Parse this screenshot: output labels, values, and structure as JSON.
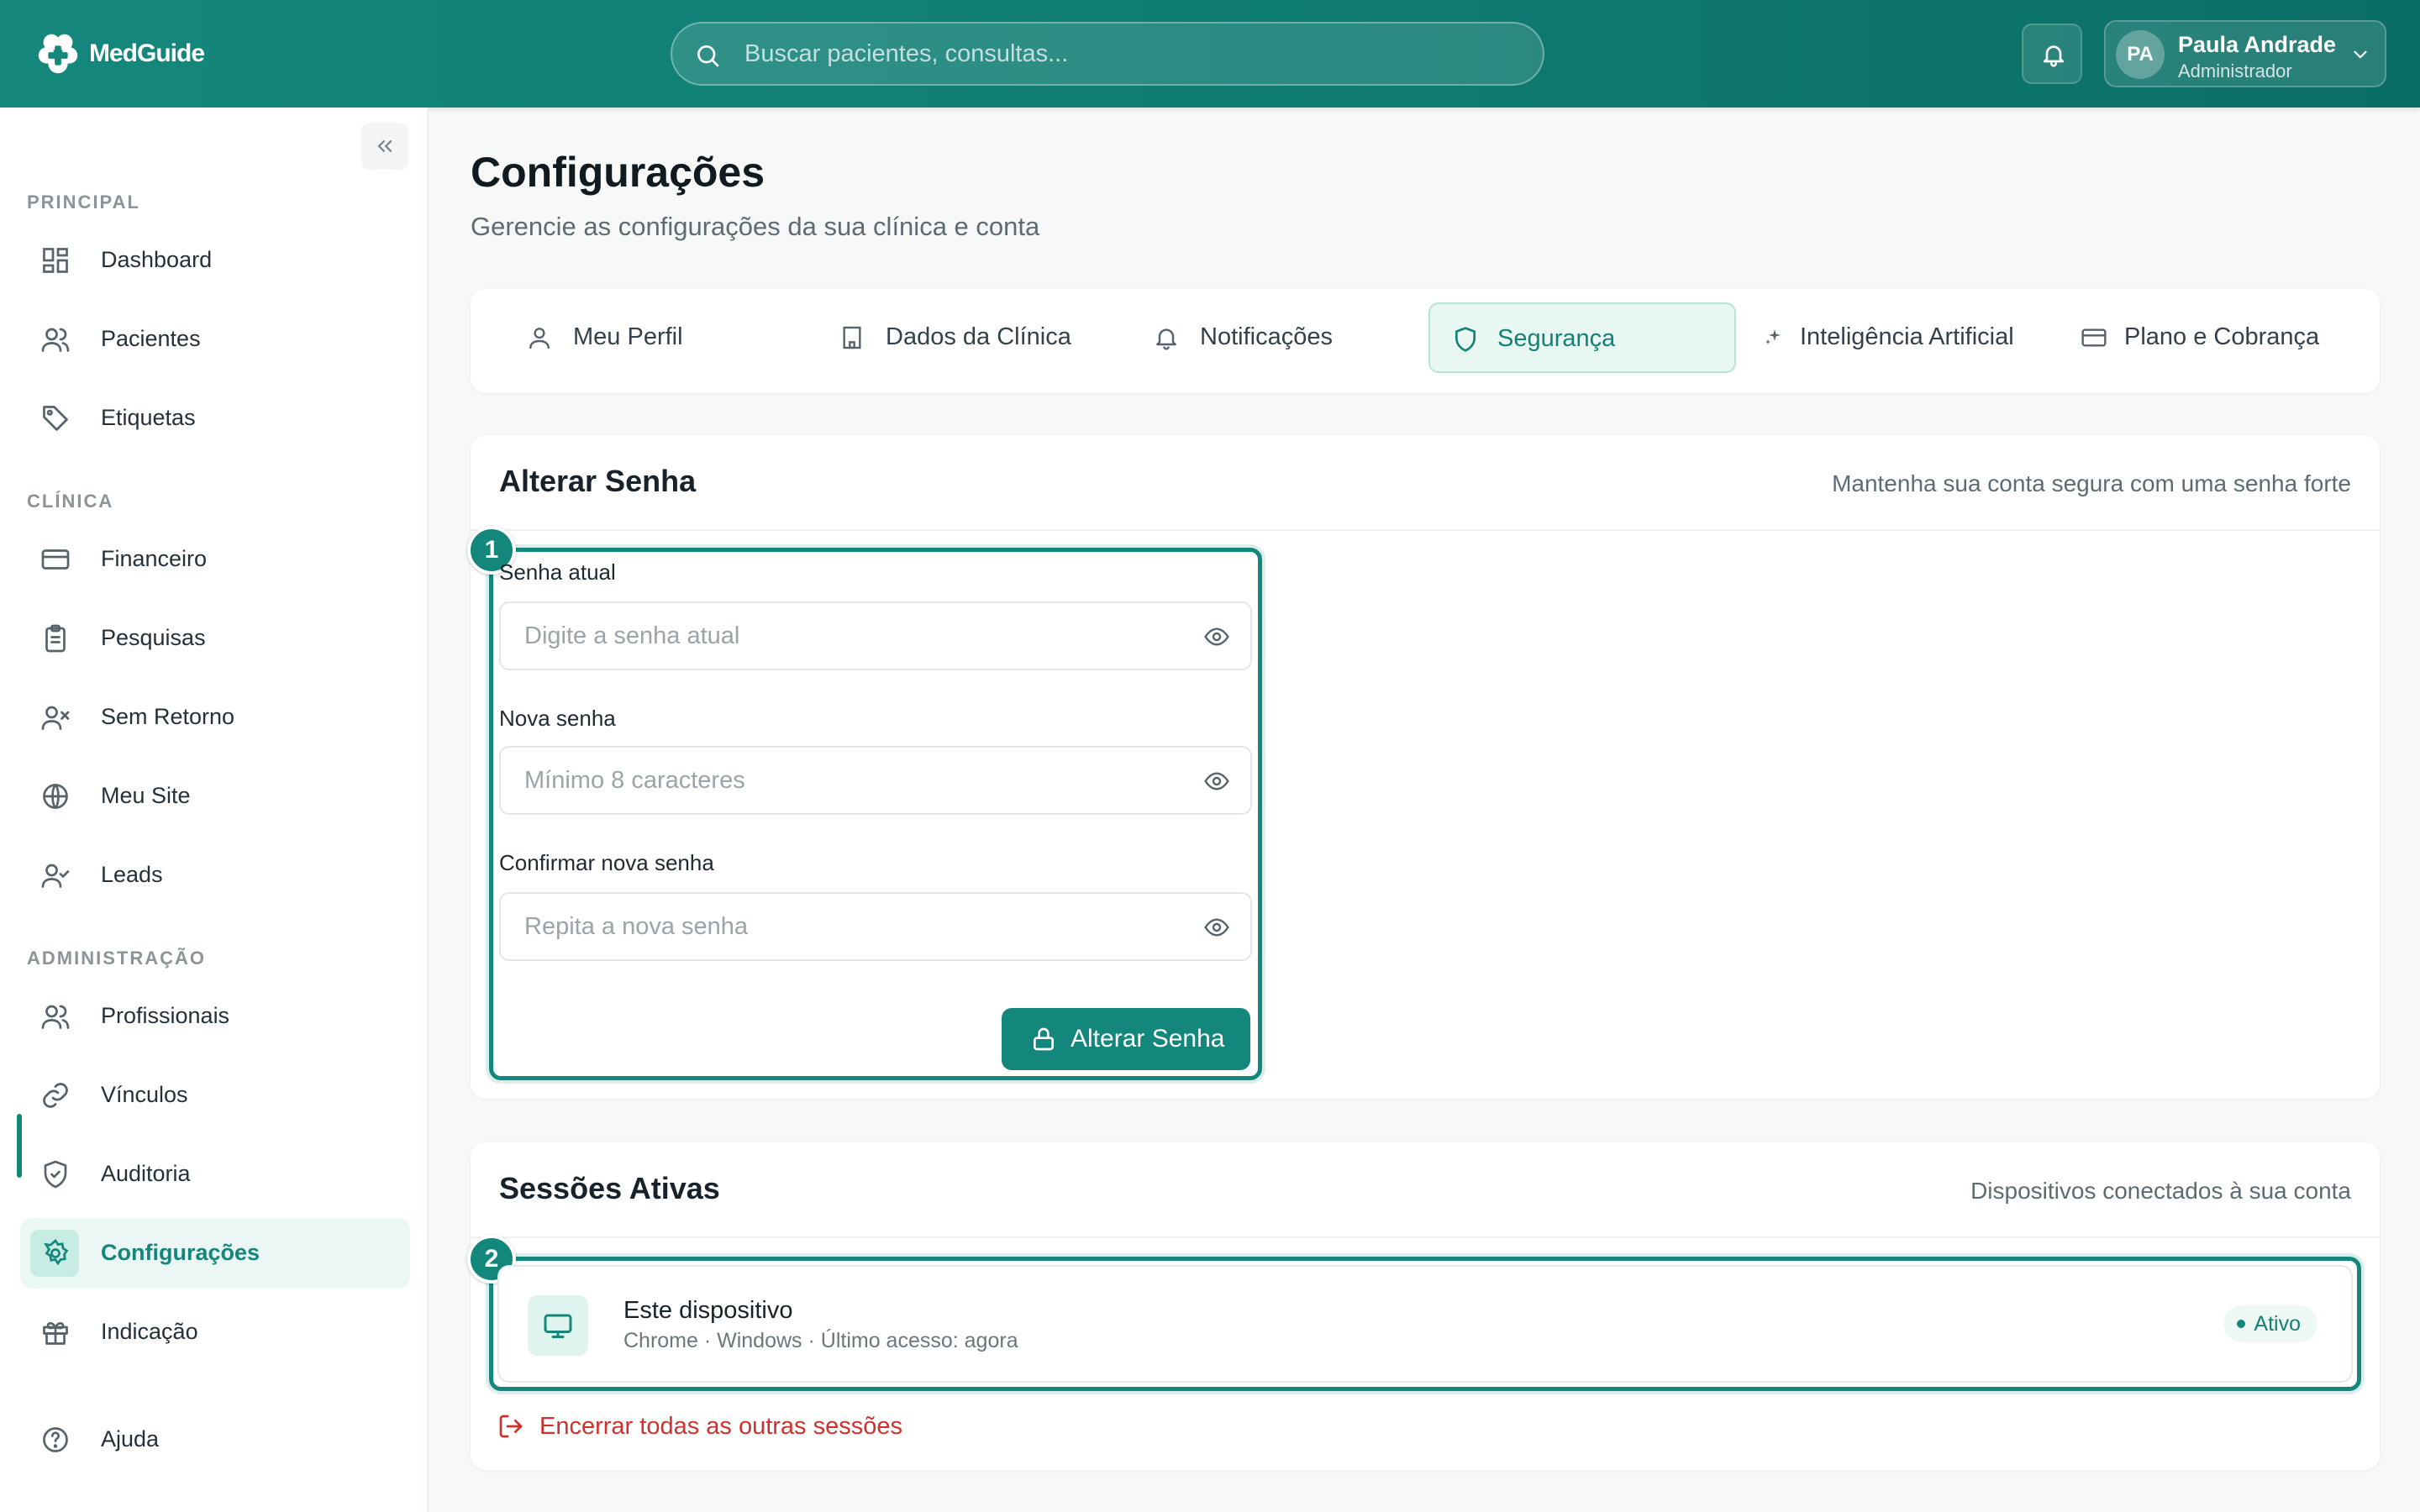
{
  "app": {
    "name": "MedGuide"
  },
  "header": {
    "search_placeholder": "Buscar pacientes, consultas...",
    "user": {
      "initials": "PA",
      "name": "Paula Andrade",
      "role": "Administrador"
    }
  },
  "sidebar": {
    "sections": {
      "principal": "PRINCIPAL",
      "clinica": "CLÍNICA",
      "administracao": "ADMINISTRAÇÃO"
    },
    "items": {
      "dashboard": "Dashboard",
      "pacientes": "Pacientes",
      "etiquetas": "Etiquetas",
      "financeiro": "Financeiro",
      "pesquisas": "Pesquisas",
      "sem_retorno": "Sem Retorno",
      "meu_site": "Meu Site",
      "leads": "Leads",
      "profissionais": "Profissionais",
      "vinculos": "Vínculos",
      "auditoria": "Auditoria",
      "configuracoes": "Configurações",
      "indicacao": "Indicação",
      "ajuda": "Ajuda"
    },
    "active": "configuracoes"
  },
  "page": {
    "title": "Configurações",
    "subtitle": "Gerencie as configurações da sua clínica e conta"
  },
  "tabs": {
    "meu_perfil": "Meu Perfil",
    "dados_clinica": "Dados da Clínica",
    "notificacoes": "Notificações",
    "seguranca": "Segurança",
    "ia": "Inteligência Artificial",
    "plano": "Plano e Cobrança",
    "active": "seguranca"
  },
  "password_card": {
    "title": "Alterar Senha",
    "hint": "Mantenha sua conta segura com uma senha forte",
    "badge": "1",
    "current_label": "Senha atual",
    "current_placeholder": "Digite a senha atual",
    "new_label": "Nova senha",
    "new_placeholder": "Mínimo 8 caracteres",
    "confirm_label": "Confirmar nova senha",
    "confirm_placeholder": "Repita a nova senha",
    "submit_label": "Alterar Senha"
  },
  "sessions_card": {
    "title": "Sessões Ativas",
    "hint": "Dispositivos conectados à sua conta",
    "badge": "2",
    "sessions": [
      {
        "name": "Este dispositivo",
        "meta": "Chrome · Windows · Último acesso: agora",
        "status": "Ativo"
      }
    ],
    "end_all_label": "Encerrar todas as outras sessões"
  },
  "colors": {
    "brand": "#14877c",
    "danger": "#d0312d",
    "active_bg": "#eaf7f4"
  },
  "icons": {
    "search": "search-icon",
    "bell": "bell-icon",
    "chevron": "chevron-down-icon",
    "eye": "eye-icon",
    "lock": "lock-icon",
    "monitor": "monitor-icon",
    "logout": "log-out-icon"
  }
}
